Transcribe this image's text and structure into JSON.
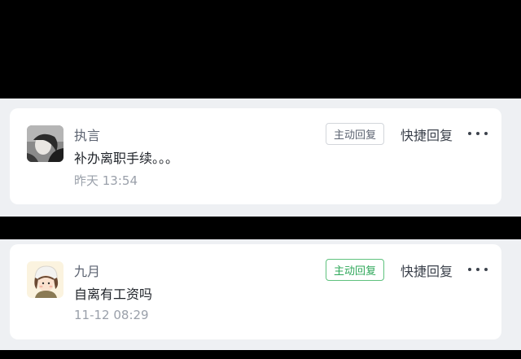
{
  "comments": [
    {
      "username": "执言",
      "text": "补办离职手续。。。",
      "time": "昨天 13:54",
      "reply_tag": "主动回复",
      "reply_tag_active": false,
      "quick_reply": "快捷回复",
      "avatar_icon": "user-avatar-dark"
    },
    {
      "username": "九月",
      "text": "自离有工资吗",
      "time": "11-12 08:29",
      "reply_tag": "主动回复",
      "reply_tag_active": true,
      "quick_reply": "快捷回复",
      "avatar_icon": "user-avatar-cartoon-girl"
    }
  ],
  "colors": {
    "background": "#000000",
    "card": "#ffffff",
    "band": "#eef0f3",
    "active_green": "#2fa85a"
  }
}
